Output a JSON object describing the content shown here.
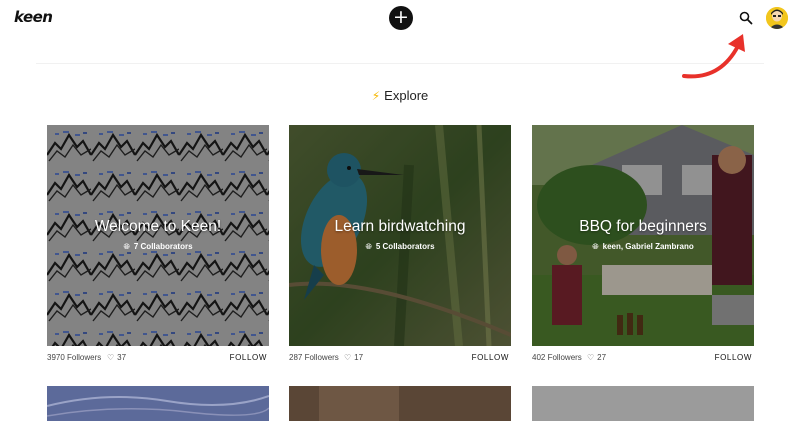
{
  "header": {
    "logo": "keen",
    "add_label": "+",
    "search_icon": "search-icon",
    "avatar_icon": "user-avatar"
  },
  "explore": {
    "label": "Explore",
    "icon": "lightning-bolt-icon",
    "icon_color": "#f5b700"
  },
  "cards": [
    {
      "title": "Welcome to Keen!",
      "collaborators": "7 Collaborators",
      "followers": "3970 Followers",
      "likes": "37",
      "follow": "FOLLOW"
    },
    {
      "title": "Learn birdwatching",
      "collaborators": "5 Collaborators",
      "followers": "287 Followers",
      "likes": "17",
      "follow": "FOLLOW"
    },
    {
      "title": "BBQ for beginners",
      "collaborators": "keen, Gabriel Zambrano",
      "followers": "402 Followers",
      "likes": "27",
      "follow": "FOLLOW"
    }
  ],
  "annotation": {
    "arrow_color": "#e8312a"
  }
}
